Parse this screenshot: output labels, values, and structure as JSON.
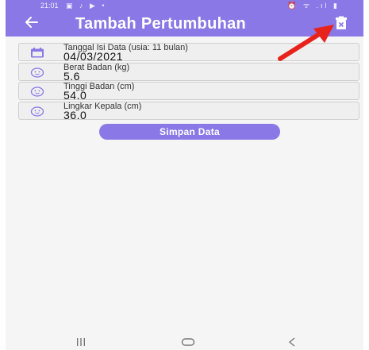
{
  "status_bar": {
    "time": "21:01",
    "left_icons": "▣ ♪ ▶ •",
    "right_icons": "⏰ ᯤ .ıl ▮"
  },
  "app_bar": {
    "title": "Tambah Pertumbuhan",
    "back_icon": "arrow-left-icon",
    "delete_icon": "trash-icon",
    "color": "#8a78e6"
  },
  "form": {
    "date": {
      "label": "Tanggal Isi Data (usia: 11 bulan)",
      "value": "04/03/2021",
      "icon": "calendar-icon"
    },
    "weight": {
      "label": "Berat Badan (kg)",
      "value": "5.6",
      "icon": "baby-face-icon"
    },
    "height": {
      "label": "Tinggi Badan (cm)",
      "value": "54.0",
      "icon": "baby-face-icon"
    },
    "head": {
      "label": "Lingkar Kepala (cm)",
      "value": "36.0",
      "icon": "baby-face-icon"
    }
  },
  "save_button": {
    "label": "Simpan Data"
  },
  "nav_bar": {
    "recents": "recents-icon",
    "home": "home-icon",
    "back": "back-icon"
  },
  "annotation": {
    "color": "#e8231b",
    "icon": "red-arrow-icon"
  }
}
